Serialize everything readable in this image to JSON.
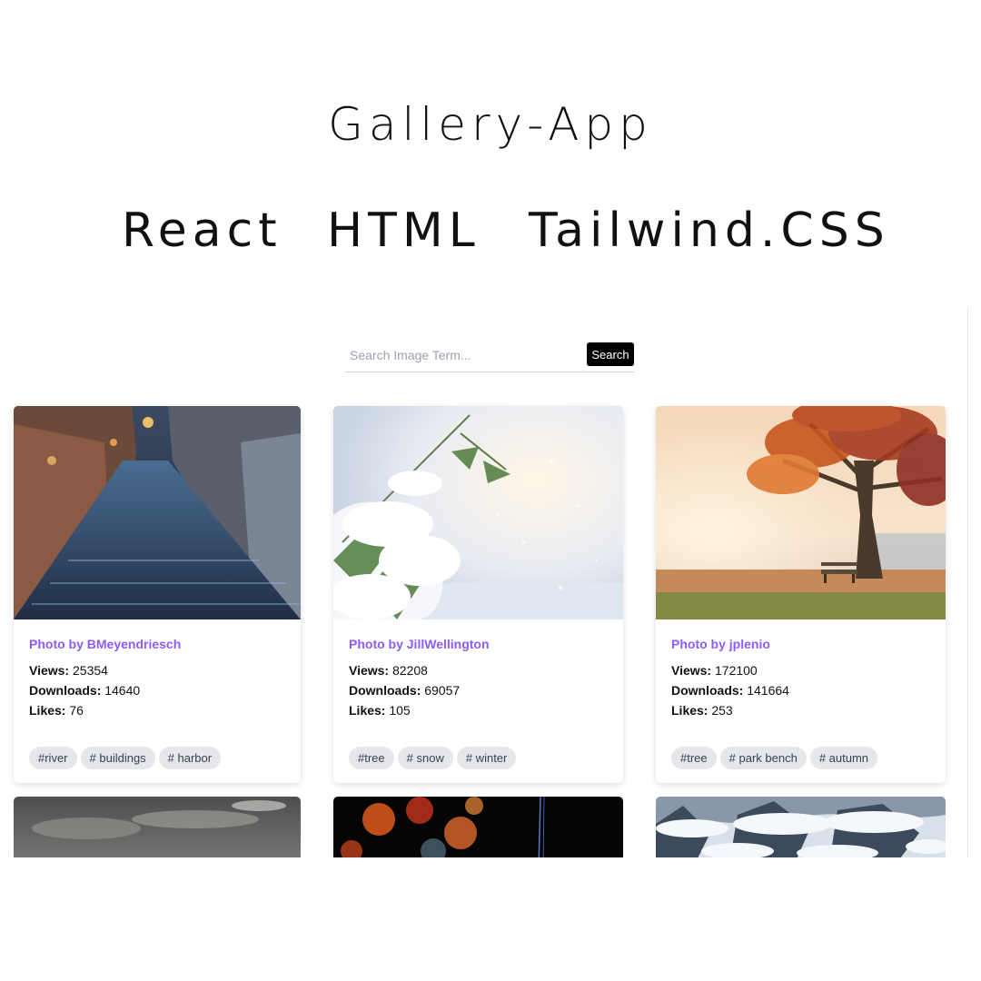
{
  "header": {
    "title": "Gallery-App",
    "technologies": [
      "React",
      "HTML",
      "Tailwind.CSS"
    ]
  },
  "search": {
    "placeholder": "Search Image Term...",
    "value": "",
    "button_label": "Search"
  },
  "stat_labels": {
    "views": "Views:",
    "downloads": "Downloads:",
    "likes": "Likes:"
  },
  "cards": [
    {
      "photo_by": "Photo by BMeyendriesch",
      "views": "25354",
      "downloads": "14640",
      "likes": "76",
      "tags": [
        "#river",
        "# buildings",
        "# harbor"
      ]
    },
    {
      "photo_by": "Photo by JillWellington",
      "views": "82208",
      "downloads": "69057",
      "likes": "105",
      "tags": [
        "#tree",
        "# snow",
        "# winter"
      ]
    },
    {
      "photo_by": "Photo by jplenio",
      "views": "172100",
      "downloads": "141664",
      "likes": "253",
      "tags": [
        "#tree",
        "# park bench",
        "# autumn"
      ]
    }
  ],
  "colors": {
    "author_accent": "#8b5cf6",
    "tag_background": "#e5e7eb",
    "search_button": "#000000"
  }
}
